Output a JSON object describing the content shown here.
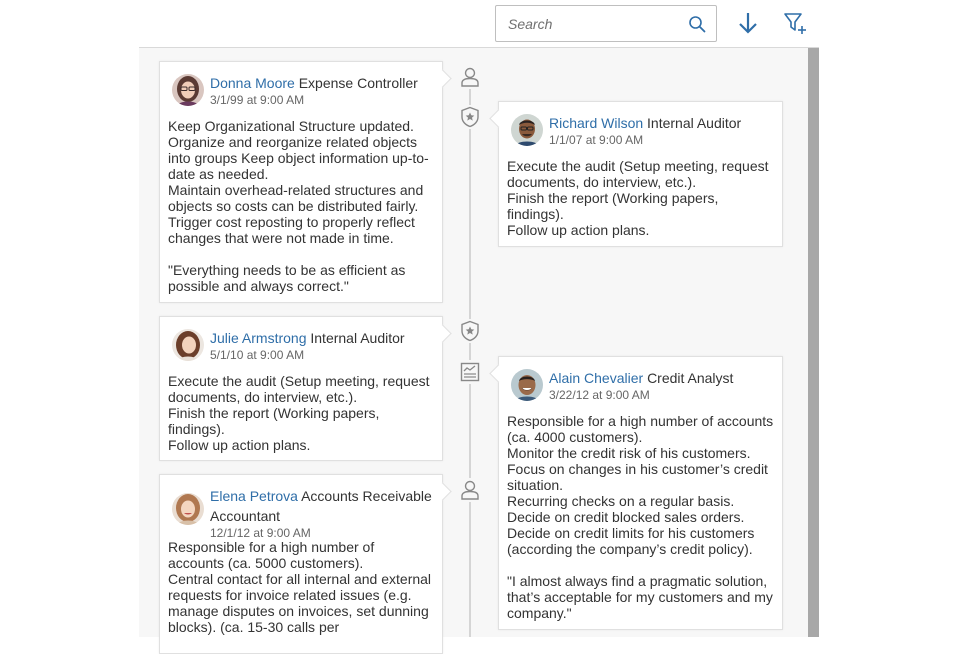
{
  "toolbar": {
    "search_placeholder": "Search",
    "search_icon": "magnifier-icon",
    "sort_icon": "arrow-down-icon",
    "filter_icon": "filter-add-icon"
  },
  "timeline": {
    "nodes": [
      {
        "icon": "person-icon"
      },
      {
        "icon": "badge-star-icon"
      },
      {
        "icon": "badge-star-icon"
      },
      {
        "icon": "report-chart-icon"
      },
      {
        "icon": "person-icon"
      }
    ],
    "items": [
      {
        "name": "Donna Moore",
        "role": "Expense Controller",
        "date": "3/1/99 at 9:00 AM",
        "text": "Keep Organizational Structure updated.\nOrganize and reorganize related objects into groups Keep object information up-to-date as needed.\nMaintain overhead-related structures and objects so costs can be distributed fairly.\nTrigger cost reposting to properly reflect changes that were not made in time.\n\n\"Everything needs to be as efficient as possible and always correct.\""
      },
      {
        "name": "Richard Wilson",
        "role": "Internal Auditor",
        "date": "1/1/07 at 9:00 AM",
        "text": "Execute the audit (Setup meeting, request documents, do interview, etc.).\nFinish the report (Working papers, findings).\nFollow up action plans."
      },
      {
        "name": "Julie Armstrong",
        "role": "Internal Auditor",
        "date": "5/1/10 at 9:00 AM",
        "text": "Execute the audit (Setup meeting, request documents, do interview, etc.).\nFinish the report (Working papers, findings).\nFollow up action plans."
      },
      {
        "name": "Alain Chevalier",
        "role": "Credit Analyst",
        "date": "3/22/12 at 9:00 AM",
        "text": "Responsible for a high number of accounts (ca. 4000 customers).\nMonitor the credit risk of his customers.\nFocus on changes in his customer’s credit situation.\nRecurring checks on a regular basis.\nDecide on credit blocked sales orders.\nDecide on credit limits for his customers (according the company’s credit policy).\n\n\"I almost always find a pragmatic solution, that’s acceptable for my customers and my company.\""
      },
      {
        "name": "Elena Petrova",
        "role": "Accounts Receivable Accountant",
        "date": "12/1/12 at 9:00 AM",
        "text": "Responsible for a high number of accounts (ca. 5000 customers).\nCentral contact for all internal and external requests for invoice related issues (e.g. manage disputes on invoices, set dunning blocks). (ca. 15-30 calls per"
      }
    ]
  }
}
